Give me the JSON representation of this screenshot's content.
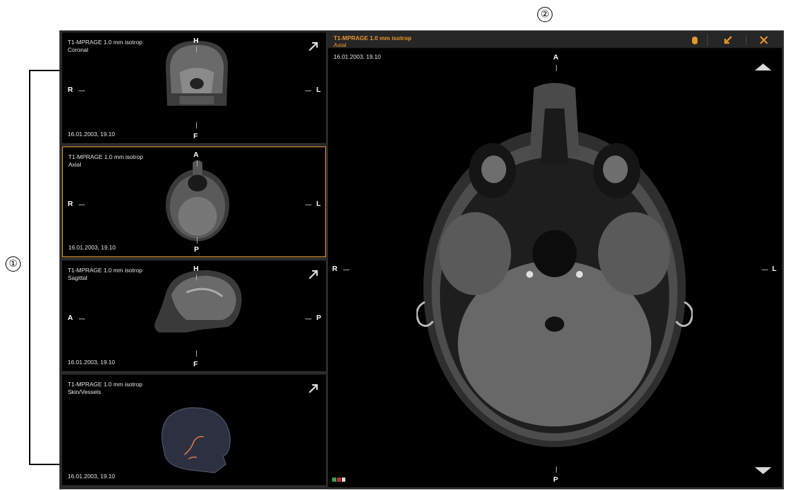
{
  "callouts": {
    "one": "①",
    "two": "②"
  },
  "thumbnails": [
    {
      "series": "T1-MPRAGE 1.0 mm isotrop",
      "view": "Coronal",
      "date": "16.01.2003, 19.10",
      "top": "H",
      "bottom": "F",
      "left": "R",
      "right": "L",
      "expand_icon": "expand-arrow-icon",
      "active": false
    },
    {
      "series": "T1-MPRAGE 1.0 mm isotrop",
      "view": "Axial",
      "date": "16.01.2003, 19.10",
      "top": "A",
      "bottom": "P",
      "left": "R",
      "right": "L",
      "active": true
    },
    {
      "series": "T1-MPRAGE 1.0 mm isotrop",
      "view": "Sagittal",
      "date": "16.01.2003, 19.10",
      "top": "H",
      "bottom": "F",
      "left": "A",
      "right": "P",
      "expand_icon": "expand-arrow-icon",
      "active": false
    },
    {
      "series": "T1-MPRAGE 1.0 mm isotrop",
      "view": "Skin/Vessels",
      "date": "16.01.2003, 19.10",
      "expand_icon": "expand-arrow-icon",
      "active": false
    }
  ],
  "main_view": {
    "series": "T1-MPRAGE 1.0 mm isotrop",
    "view": "Axial",
    "date": "16.01.2003, 19.10",
    "top": "A",
    "bottom": "P",
    "left": "R",
    "right": "L",
    "header_buttons": [
      "hand-icon",
      "collapse-arrow-icon",
      "close-icon"
    ]
  },
  "colors": {
    "accent": "#e8952b",
    "panel": "#000000",
    "frame": "#2b2b2b"
  }
}
